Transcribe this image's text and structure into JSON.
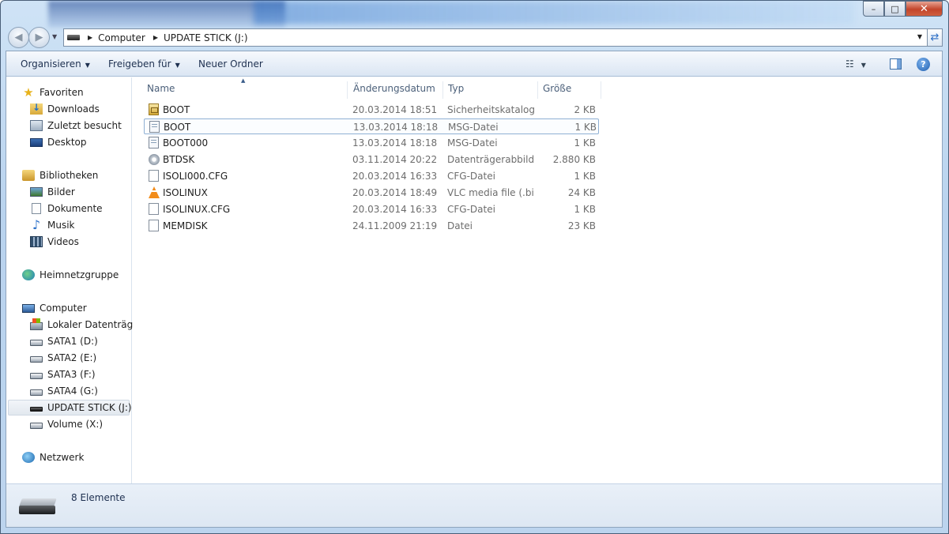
{
  "window": {
    "controls": {
      "minimize": "–",
      "maximize": "□",
      "close": "✕"
    }
  },
  "address": {
    "crumbs": [
      "Computer",
      "UPDATE STICK (J:)"
    ]
  },
  "toolbar": {
    "organize": "Organisieren",
    "share": "Freigeben für",
    "new_folder": "Neuer Ordner",
    "help": "?"
  },
  "nav": {
    "favorites": "Favoriten",
    "downloads": "Downloads",
    "recent": "Zuletzt besucht",
    "desktop": "Desktop",
    "libraries": "Bibliotheken",
    "pictures": "Bilder",
    "documents": "Dokumente",
    "music": "Musik",
    "videos": "Videos",
    "homegroup": "Heimnetzgruppe",
    "computer": "Computer",
    "local_disk": "Lokaler Datenträger",
    "sata1": "SATA1 (D:)",
    "sata2": "SATA2 (E:)",
    "sata3": "SATA3 (F:)",
    "sata4": "SATA4 (G:)",
    "update_stick": "UPDATE STICK (J:)",
    "volume": "Volume (X:)",
    "network": "Netzwerk"
  },
  "columns": {
    "name": "Name",
    "date": "Änderungsdatum",
    "type": "Typ",
    "size": "Größe"
  },
  "files": [
    {
      "name": "BOOT",
      "date": "20.03.2014 18:51",
      "type": "Sicherheitskatalog",
      "size": "2 KB",
      "icon": "catalog-icon"
    },
    {
      "name": "BOOT",
      "date": "13.03.2014 18:18",
      "type": "MSG-Datei",
      "size": "1 KB",
      "icon": "msg-file-icon"
    },
    {
      "name": "BOOT000",
      "date": "13.03.2014 18:18",
      "type": "MSG-Datei",
      "size": "1 KB",
      "icon": "msg-file-icon"
    },
    {
      "name": "BTDSK",
      "date": "03.11.2014 20:22",
      "type": "Datenträgerabbild...",
      "size": "2.880 KB",
      "icon": "disk-image-icon"
    },
    {
      "name": "ISOLI000.CFG",
      "date": "20.03.2014 16:33",
      "type": "CFG-Datei",
      "size": "1 KB",
      "icon": "file-icon"
    },
    {
      "name": "ISOLINUX",
      "date": "20.03.2014 18:49",
      "type": "VLC media file (.bi...",
      "size": "24 KB",
      "icon": "vlc-icon"
    },
    {
      "name": "ISOLINUX.CFG",
      "date": "20.03.2014 16:33",
      "type": "CFG-Datei",
      "size": "1 KB",
      "icon": "file-icon"
    },
    {
      "name": "MEMDISK",
      "date": "24.11.2009 21:19",
      "type": "Datei",
      "size": "23 KB",
      "icon": "file-icon"
    }
  ],
  "details": {
    "count": "8 Elemente"
  }
}
